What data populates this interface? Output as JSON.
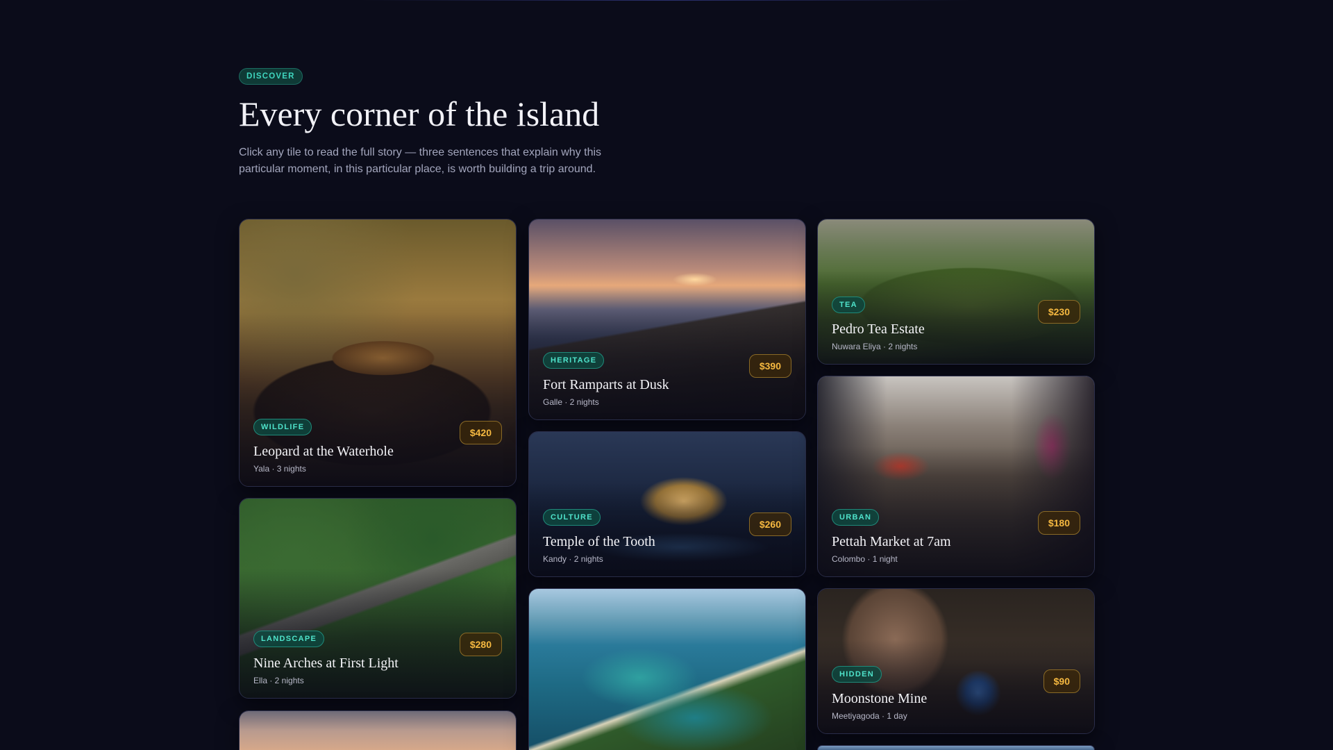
{
  "header": {
    "eyebrow": "DISCOVER",
    "title": "Every corner of the island",
    "subtitle": "Click any tile to read the full story — three sentences that explain why this particular moment, in this particular place, is worth building a trip around."
  },
  "cards": [
    {
      "tag": "WILDLIFE",
      "title": "Leopard at the Waterhole",
      "sub": "Yala · 3 nights",
      "price": "$420"
    },
    {
      "tag": "HERITAGE",
      "title": "Fort Ramparts at Dusk",
      "sub": "Galle · 2 nights",
      "price": "$390"
    },
    {
      "tag": "TEA",
      "title": "Pedro Tea Estate",
      "sub": "Nuwara Eliya · 2 nights",
      "price": "$230"
    },
    {
      "tag": "CULTURE",
      "title": "Temple of the Tooth",
      "sub": "Kandy · 2 nights",
      "price": "$260"
    },
    {
      "tag": "URBAN",
      "title": "Pettah Market at 7am",
      "sub": "Colombo · 1 night",
      "price": "$180"
    },
    {
      "tag": "LANDSCAPE",
      "title": "Nine Arches at First Light",
      "sub": "Ella · 2 nights",
      "price": "$280"
    },
    {
      "tag": "HIDDEN",
      "title": "Moonstone Mine",
      "sub": "Meetiyagoda · 1 day",
      "price": "$90"
    }
  ]
}
